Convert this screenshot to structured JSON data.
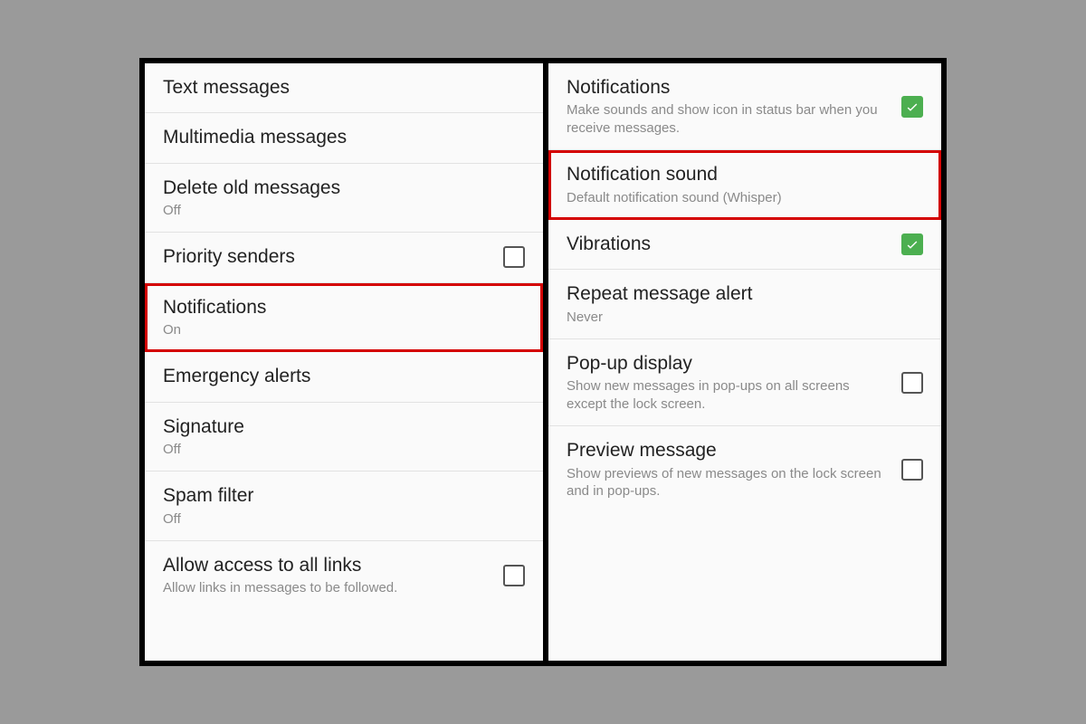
{
  "left": {
    "rows": [
      {
        "id": "text-messages",
        "title": "Text messages",
        "sub": null,
        "control": null,
        "highlighted": false
      },
      {
        "id": "multimedia-messages",
        "title": "Multimedia messages",
        "sub": null,
        "control": null,
        "highlighted": false
      },
      {
        "id": "delete-old-messages",
        "title": "Delete old messages",
        "sub": "Off",
        "control": null,
        "highlighted": false
      },
      {
        "id": "priority-senders",
        "title": "Priority senders",
        "sub": null,
        "control": "checkbox",
        "checked": false,
        "highlighted": false
      },
      {
        "id": "notifications",
        "title": "Notifications",
        "sub": "On",
        "control": null,
        "highlighted": true
      },
      {
        "id": "emergency-alerts",
        "title": "Emergency alerts",
        "sub": null,
        "control": null,
        "highlighted": false
      },
      {
        "id": "signature",
        "title": "Signature",
        "sub": "Off",
        "control": null,
        "highlighted": false
      },
      {
        "id": "spam-filter",
        "title": "Spam filter",
        "sub": "Off",
        "control": null,
        "highlighted": false
      },
      {
        "id": "allow-links",
        "title": "Allow access to all links",
        "sub": "Allow links in messages to be followed.",
        "control": "checkbox",
        "checked": false,
        "highlighted": false
      }
    ]
  },
  "right": {
    "rows": [
      {
        "id": "notifications-master",
        "title": "Notifications",
        "sub": "Make sounds and show icon in status bar when you receive messages.",
        "control": "checkbox",
        "checked": true,
        "highlighted": false
      },
      {
        "id": "notification-sound",
        "title": "Notification sound",
        "sub": "Default notification sound (Whisper)",
        "control": null,
        "highlighted": true
      },
      {
        "id": "vibrations",
        "title": "Vibrations",
        "sub": null,
        "control": "checkbox",
        "checked": true,
        "highlighted": false
      },
      {
        "id": "repeat-alert",
        "title": "Repeat message alert",
        "sub": "Never",
        "control": null,
        "highlighted": false
      },
      {
        "id": "popup-display",
        "title": "Pop-up display",
        "sub": "Show new messages in pop-ups on all screens except the lock screen.",
        "control": "checkbox",
        "checked": false,
        "highlighted": false
      },
      {
        "id": "preview-message",
        "title": "Preview message",
        "sub": "Show previews of new messages on the lock screen and in pop-ups.",
        "control": "checkbox",
        "checked": false,
        "highlighted": false
      }
    ]
  }
}
